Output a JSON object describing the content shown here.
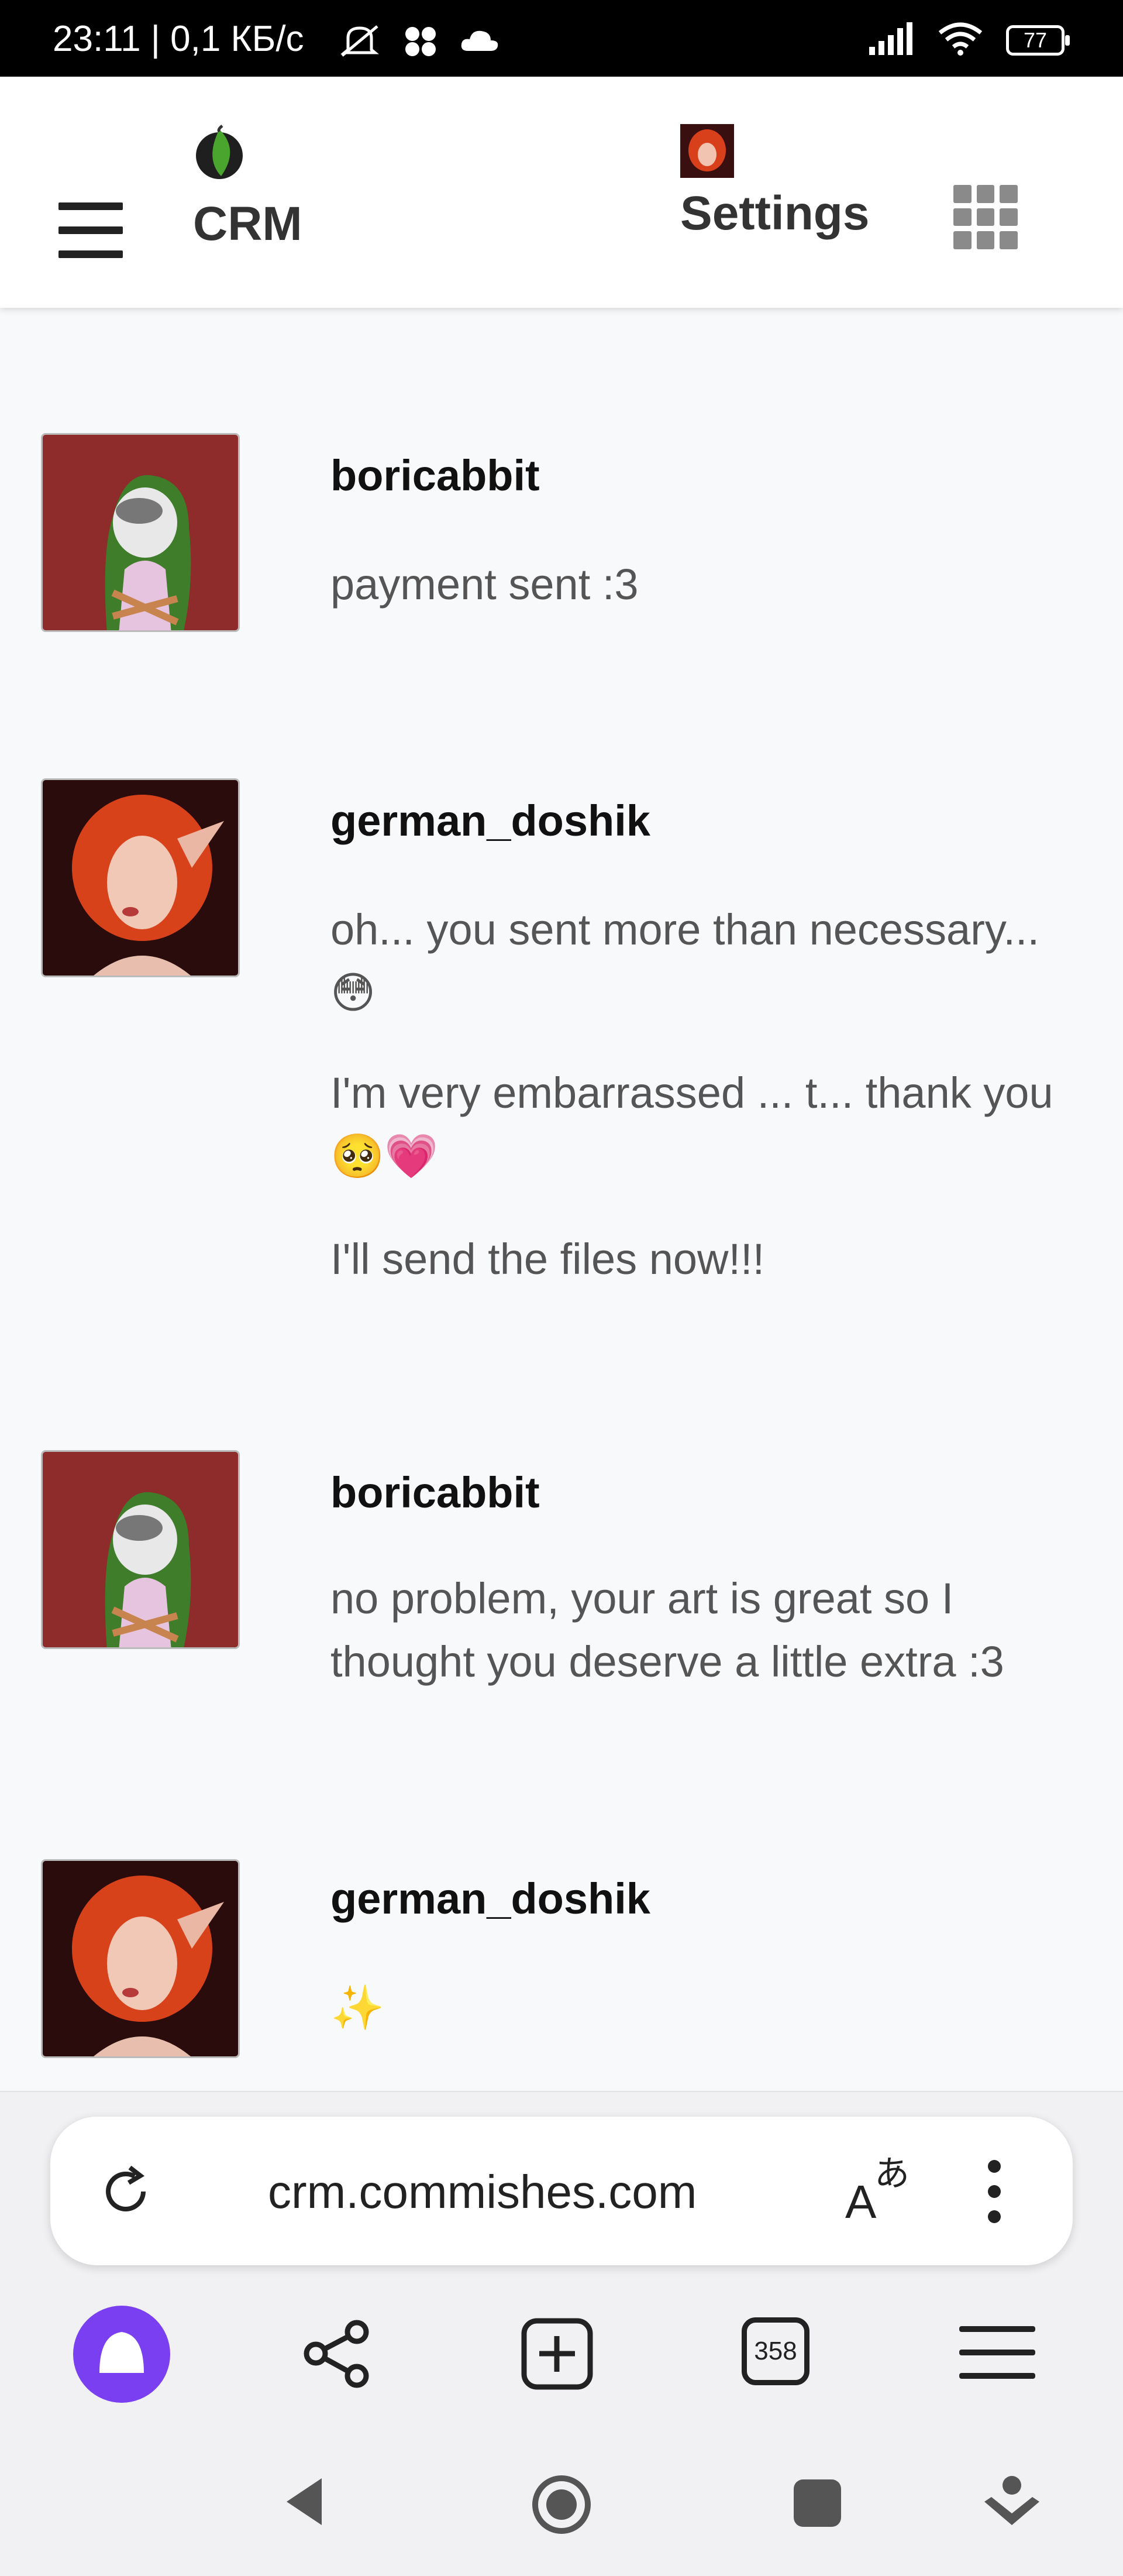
{
  "status_bar": {
    "time_speed": "23:11 | 0,1 КБ/с",
    "battery": "77"
  },
  "header": {
    "app_title": "CRM",
    "settings_label": "Settings"
  },
  "messages": [
    {
      "user": "boricabbit",
      "lines": [
        "payment sent :3"
      ]
    },
    {
      "user": "german_doshik",
      "lines": [
        "oh... you sent more than necessary... 😳",
        "I'm very embarrassed ... t... thank you 🥺💗",
        "I'll send the files now!!!"
      ]
    },
    {
      "user": "boricabbit",
      "lines": [
        "no problem, your art is great so I thought you deserve a little extra :3"
      ]
    },
    {
      "user": "german_doshik",
      "lines": [
        "✨"
      ]
    }
  ],
  "browser": {
    "url": "crm.commishes.com",
    "tab_count": "358"
  },
  "colors": {
    "accent_purple": "#7b3ff2",
    "background": "#f8f9fb",
    "avatar_red": "#8e2b2b"
  }
}
